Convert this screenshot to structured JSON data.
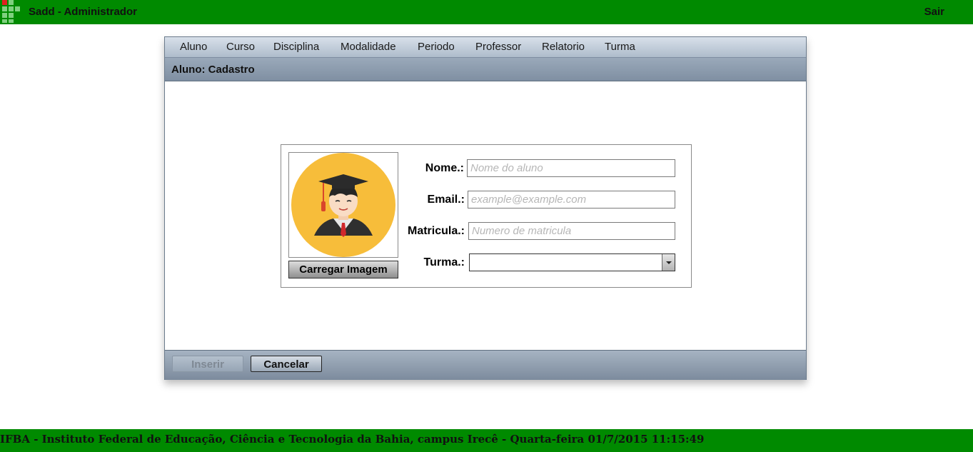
{
  "header": {
    "app_title": "Sadd - Administrador",
    "logout_label": "Sair"
  },
  "menu": {
    "items": [
      {
        "label": "Aluno"
      },
      {
        "label": "Curso"
      },
      {
        "label": "Disciplina"
      },
      {
        "label": "Modalidade"
      },
      {
        "label": "Periodo"
      },
      {
        "label": "Professor"
      },
      {
        "label": "Relatorio"
      },
      {
        "label": "Turma"
      }
    ]
  },
  "panel": {
    "title": "Aluno: Cadastro"
  },
  "form": {
    "upload_label": "Carregar Imagem",
    "name": {
      "label": "Nome.:",
      "placeholder": "Nome do aluno",
      "value": ""
    },
    "email": {
      "label": "Email.:",
      "placeholder": "example@example.com",
      "value": ""
    },
    "matricula": {
      "label": "Matricula.:",
      "placeholder": "Numero de matricula",
      "value": ""
    },
    "turma": {
      "label": "Turma.:",
      "value": ""
    }
  },
  "actions": {
    "insert_label": "Inserir",
    "cancel_label": "Cancelar"
  },
  "footer": {
    "text": "IFBA - Instituto Federal de Educação, Ciência e Tecnologia da Bahia, campus Irecê - Quarta-feira 01/7/2015 11:15:49"
  },
  "colors": {
    "brand_green": "#008a00",
    "avatar_bg": "#f7bd3a",
    "cap": "#2b2b2b",
    "tassel": "#d9462b"
  }
}
